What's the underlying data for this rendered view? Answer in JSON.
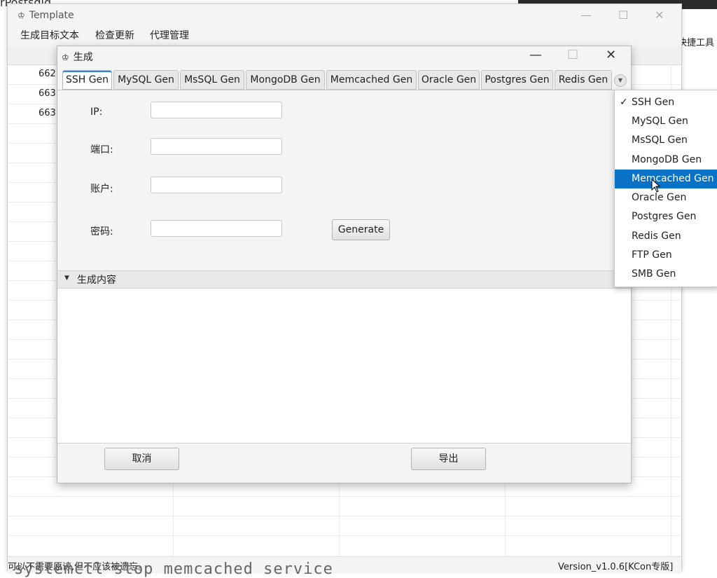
{
  "background": {
    "top_title": "rPostsdld...",
    "right_label": "快捷工具",
    "bottom_code": "systemctl stop memcached service"
  },
  "main_window": {
    "title": "Template",
    "menu": [
      "生成目标文本",
      "检查更新",
      "代理管理"
    ],
    "rows": [
      "662",
      "663",
      "663"
    ],
    "status_left": "可以不需要原谅,但不应该被遗忘。",
    "status_right": "Version_v1.0.6[KCon专版]"
  },
  "dialog": {
    "title": "生成",
    "tabs": [
      "SSH Gen",
      "MySQL Gen",
      "MsSQL Gen",
      "MongoDB Gen",
      "Memcached Gen",
      "Oracle Gen",
      "Postgres Gen",
      "Redis Gen"
    ],
    "active_tab": "SSH Gen",
    "fields": {
      "ip_label": "IP:",
      "port_label": "端口:",
      "account_label": "账户:",
      "password_label": "密码:"
    },
    "generate_label": "Generate",
    "section_title": "生成内容",
    "cancel_label": "取消",
    "export_label": "导出"
  },
  "dropdown": {
    "items": [
      "SSH Gen",
      "MySQL Gen",
      "MsSQL Gen",
      "MongoDB Gen",
      "Memcached Gen",
      "Oracle Gen",
      "Postgres Gen",
      "Redis Gen",
      "FTP Gen",
      "SMB Gen"
    ],
    "checked": "SSH Gen",
    "highlighted": "Memcached Gen"
  },
  "colors": {
    "highlight": "#0a72c7",
    "active_tab_accent": "#3a87c8"
  }
}
